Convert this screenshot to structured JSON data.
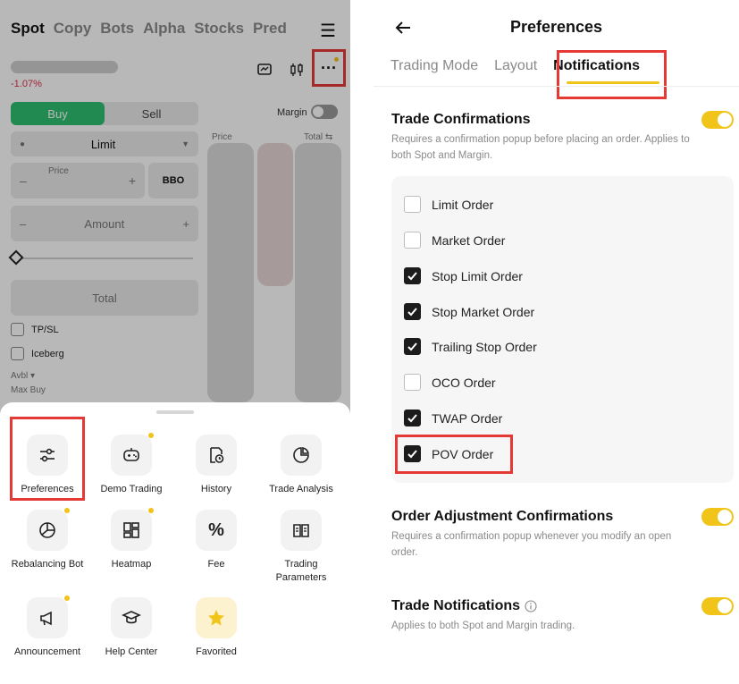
{
  "left": {
    "topnav": [
      "Spot",
      "Copy",
      "Bots",
      "Alpha",
      "Stocks",
      "Pred"
    ],
    "price_change": "-1.07%",
    "buy_label": "Buy",
    "sell_label": "Sell",
    "margin_label": "Margin",
    "order_type": "Limit",
    "ob_price_header": "Price",
    "ob_total_header": "Total ⇆",
    "price_label": "Price",
    "bbo_label": "BBO",
    "amount_label": "Amount",
    "total_label": "Total",
    "tpsl_label": "TP/SL",
    "iceberg_label": "Iceberg",
    "avbl_label": "Avbl ▾",
    "max_buy_label": "Max Buy",
    "menu": [
      {
        "label": "Preferences",
        "icon": "sliders-icon"
      },
      {
        "label": "Demo Trading",
        "icon": "gamepad-icon"
      },
      {
        "label": "History",
        "icon": "history-icon"
      },
      {
        "label": "Trade Analysis",
        "icon": "analysis-icon"
      },
      {
        "label": "Rebalancing Bot",
        "icon": "rebalance-icon"
      },
      {
        "label": "Heatmap",
        "icon": "heatmap-icon"
      },
      {
        "label": "Fee",
        "icon": "percent-icon"
      },
      {
        "label": "Trading Parameters",
        "icon": "book-icon"
      },
      {
        "label": "Announcement",
        "icon": "megaphone-icon"
      },
      {
        "label": "Help Center",
        "icon": "graduation-icon"
      },
      {
        "label": "Favorited",
        "icon": "star-icon"
      }
    ]
  },
  "right": {
    "title": "Preferences",
    "tabs": [
      "Trading Mode",
      "Layout",
      "Notifications"
    ],
    "active_tab": "Notifications",
    "trade_confirmations": {
      "title": "Trade Confirmations",
      "desc": "Requires a confirmation popup before placing an order. Applies to both Spot and Margin.",
      "enabled": true
    },
    "options": [
      {
        "label": "Limit Order",
        "checked": false
      },
      {
        "label": "Market Order",
        "checked": false
      },
      {
        "label": "Stop Limit Order",
        "checked": true
      },
      {
        "label": "Stop Market Order",
        "checked": true
      },
      {
        "label": "Trailing Stop Order",
        "checked": true
      },
      {
        "label": "OCO Order",
        "checked": false
      },
      {
        "label": "TWAP Order",
        "checked": true
      },
      {
        "label": "POV Order",
        "checked": true
      }
    ],
    "order_adjustment": {
      "title": "Order Adjustment Confirmations",
      "desc": "Requires a confirmation popup whenever you modify an open order.",
      "enabled": true
    },
    "trade_notifications": {
      "title": "Trade Notifications",
      "desc": "Applies to both Spot and Margin trading.",
      "enabled": true
    }
  },
  "colors": {
    "accent": "#f0c419",
    "highlight": "#e53935",
    "buy": "#2fbf71",
    "down": "#e0314b"
  }
}
